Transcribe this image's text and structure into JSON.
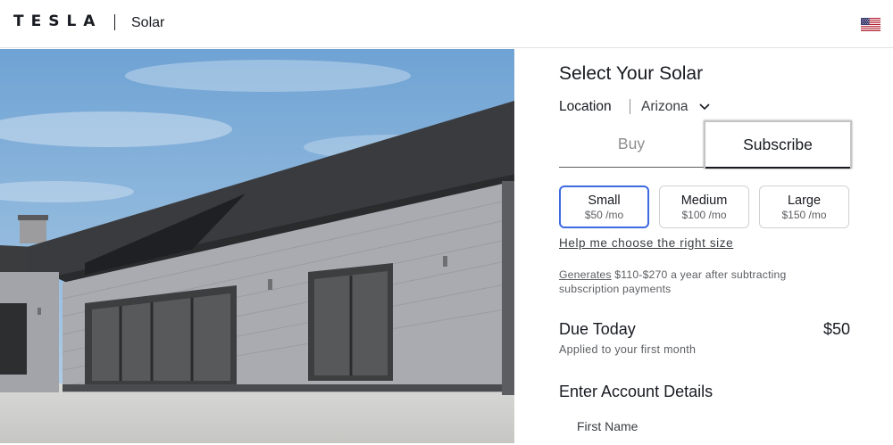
{
  "header": {
    "brand": "TESLA",
    "product": "Solar",
    "region_icon": "us-flag-icon"
  },
  "configurator": {
    "title": "Select Your Solar",
    "location_label": "Location",
    "location_value": "Arizona",
    "tabs": [
      {
        "label": "Buy",
        "selected": false
      },
      {
        "label": "Subscribe",
        "selected": true
      }
    ],
    "sizes": [
      {
        "name": "Small",
        "price": "$50 /mo",
        "selected": true
      },
      {
        "name": "Medium",
        "price": "$100 /mo",
        "selected": false
      },
      {
        "name": "Large",
        "price": "$150 /mo",
        "selected": false
      }
    ],
    "help_link": "Help me choose the right size",
    "generates_link": "Generates",
    "generates_text": " $110-$270 a year after subtracting subscription payments",
    "due_today_label": "Due Today",
    "due_today_amount": "$50",
    "due_today_note": "Applied to your first month",
    "account_heading": "Enter Account Details",
    "first_name_label": "First Name",
    "first_name_value": ""
  },
  "colors": {
    "accent": "#3e6ae1",
    "text": "#171a20",
    "muted": "#5c5e62"
  }
}
